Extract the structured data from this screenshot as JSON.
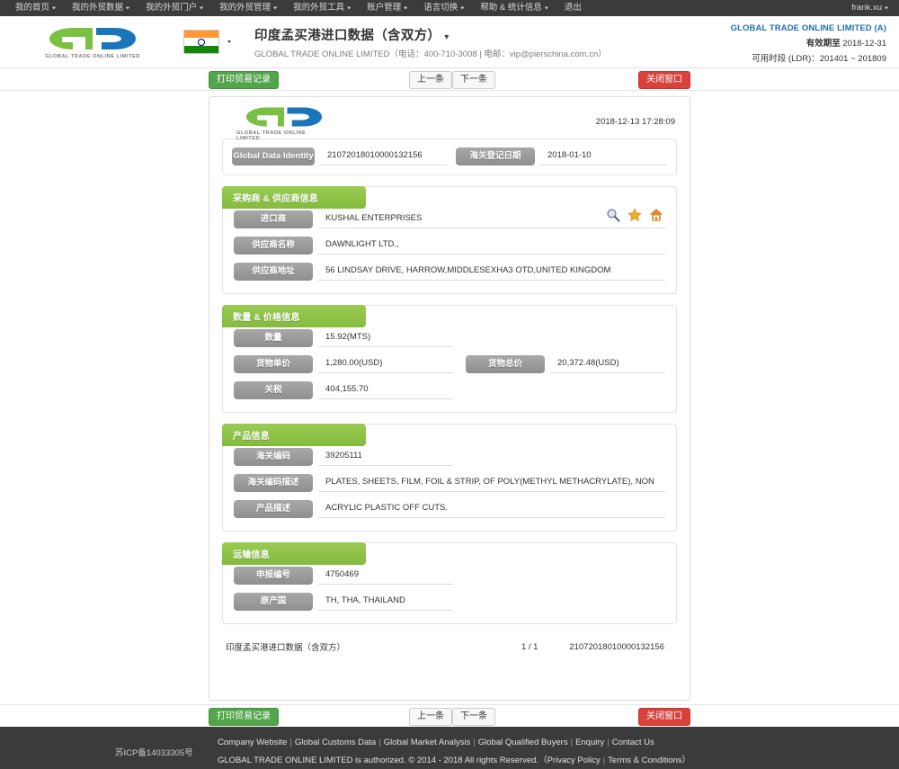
{
  "topnav": {
    "items": [
      {
        "label": "我的首页",
        "caret": true
      },
      {
        "label": "我的外贸数据",
        "caret": true
      },
      {
        "label": "我的外贸门户",
        "caret": true
      },
      {
        "label": "我的外贸管理",
        "caret": true
      },
      {
        "label": "我的外贸工具",
        "caret": true
      },
      {
        "label": "账户管理",
        "caret": true
      },
      {
        "label": "语言切换",
        "caret": true
      },
      {
        "label": "帮助 & 统计信息",
        "caret": true
      },
      {
        "label": "退出",
        "caret": false
      }
    ],
    "user": "frank.xu",
    "user_caret": "▾"
  },
  "header": {
    "logo_text": "GTO",
    "logo_sub": "GLOBAL TRADE ONLINE LIMITED",
    "flag": "india-flag",
    "flag_caret": "▾",
    "title": "印度孟买港进口数据（含双方）",
    "title_caret": "▾",
    "subtitle": "GLOBAL TRADE ONLINE LIMITED（电话：400-710-3008 | 电邮：vip@pierschina.com.cn）",
    "account_company": "GLOBAL TRADE ONLINE LIMITED (A)",
    "account_validity_label": "有效期至",
    "account_validity_value": "2018-12-31",
    "account_period": "可用时段 (LDR)：201401 ~ 201809"
  },
  "toolbar": {
    "print_label": "打印贸易记录",
    "prev_label": "上一条",
    "next_label": "下一条",
    "close_label": "关闭窗口"
  },
  "document": {
    "logo_text": "GTO",
    "logo_sub": "GLOBAL TRADE ONLINE LIMITED",
    "timestamp": "2018-12-13 17:28:09",
    "identity": {
      "gdi_label": "Global Data Identity",
      "gdi_value": "21072018010000132156",
      "customs_date_label": "海关登记日期",
      "customs_date_value": "2018-01-10"
    },
    "sections": [
      {
        "title": "采购商 & 供应商信息",
        "has_icons": true,
        "icons": [
          "search-icon",
          "star-icon",
          "home-icon"
        ],
        "rows": [
          {
            "label": "进口商",
            "value": "KUSHAL ENTERPRISES"
          },
          {
            "label": "供应商名称",
            "value": "DAWNLIGHT LTD.,"
          },
          {
            "label": "供应商地址",
            "value": "56 LINDSAY DRIVE, HARROW,MIDDLESEXHA3 OTD,UNITED KINGDOM"
          }
        ]
      },
      {
        "title": "数量 & 价格信息",
        "has_icons": false,
        "rows": [
          {
            "label": "数量",
            "value": "15.92(MTS)",
            "short": true
          },
          {
            "label": "货物单价",
            "value": "1,280.00(USD)",
            "short": true,
            "label2": "货物总价",
            "value2": "20,372.48(USD)"
          },
          {
            "label": "关税",
            "value": "404,155.70",
            "short": true
          }
        ]
      },
      {
        "title": "产品信息",
        "has_icons": false,
        "rows": [
          {
            "label": "海关编码",
            "value": "39205111",
            "short": true
          },
          {
            "label": "海关编码描述",
            "value": "PLATES, SHEETS, FILM, FOIL & STRIP, OF POLY(METHYL METHACRYLATE), NON"
          },
          {
            "label": "产品描述",
            "value": "ACRYLIC PLASTIC OFF CUTS."
          }
        ]
      },
      {
        "title": "运输信息",
        "has_icons": false,
        "rows": [
          {
            "label": "申报编号",
            "value": "4750469",
            "short": true
          },
          {
            "label": "原产国",
            "value": "TH, THA, THAILAND",
            "short": true
          }
        ]
      }
    ],
    "footer": {
      "name": "印度孟买港进口数据（含双方）",
      "page": "1 / 1",
      "id": "21072018010000132156"
    }
  },
  "pagefooter": {
    "icp": "苏ICP备14033305号",
    "links": [
      "Company Website",
      "Global Customs Data",
      "Global Market Analysis",
      "Global Qualified Buyers",
      "Enquiry",
      "Contact Us"
    ],
    "copyright_prefix": "GLOBAL TRADE ONLINE LIMITED is authorized. © 2014 - 2018 All rights Reserved.（",
    "privacy": "Privacy Policy",
    "terms": "Terms & Conditions",
    "copyright_suffix": "）"
  },
  "colors": {
    "nav_bg": "#3b3b3b",
    "green": "#84bb3e",
    "btn_green": "#52a54b",
    "btn_red": "#d9413b",
    "pill_gray": "#8f8f8f",
    "link_blue": "#1f6fb8"
  }
}
